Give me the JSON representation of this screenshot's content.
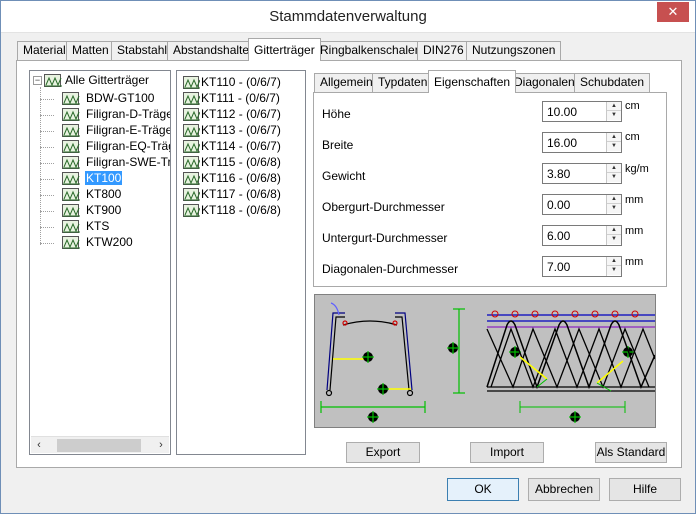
{
  "window": {
    "title": "Stammdatenverwaltung",
    "close_label": "✕"
  },
  "tabs": [
    "Material",
    "Matten",
    "Stabstahl",
    "Abstandshalter",
    "Gitterträger",
    "Ringbalkenschalen",
    "DIN276",
    "Nutzungszonen"
  ],
  "active_tab": "Gitterträger",
  "tree": {
    "root": "Alle Gitterträger",
    "items": [
      "BDW-GT100",
      "Filigran-D-Träger",
      "Filigran-E-Träger",
      "Filigran-EQ-Träger",
      "Filigran-SWE-Träg",
      "KT100",
      "KT800",
      "KT900",
      "KTS",
      "KTW200"
    ],
    "selected": "KT100"
  },
  "list": {
    "items": [
      "KT110 - (0/6/7)",
      "KT111 - (0/6/7)",
      "KT112 - (0/6/7)",
      "KT113 - (0/6/7)",
      "KT114 - (0/6/7)",
      "KT115 - (0/6/8)",
      "KT116 - (0/6/8)",
      "KT117 - (0/6/8)",
      "KT118 - (0/6/8)"
    ]
  },
  "subtabs": [
    "Allgemein",
    "Typdaten",
    "Eigenschaften",
    "Diagonalen",
    "Schubdaten"
  ],
  "active_subtab": "Eigenschaften",
  "properties": [
    {
      "label": "Höhe",
      "value": "10.00",
      "unit": "cm"
    },
    {
      "label": "Breite",
      "value": "16.00",
      "unit": "cm"
    },
    {
      "label": "Gewicht",
      "value": "3.80",
      "unit": "kg/m"
    },
    {
      "label": "Obergurt-Durchmesser",
      "value": "0.00",
      "unit": "mm"
    },
    {
      "label": "Untergurt-Durchmesser",
      "value": "6.00",
      "unit": "mm"
    },
    {
      "label": "Diagonalen-Durchmesser",
      "value": "7.00",
      "unit": "mm"
    }
  ],
  "buttons": {
    "export": "Export",
    "import": "Import",
    "standard": "Als Standard",
    "ok": "OK",
    "cancel": "Abbrechen",
    "help": "Hilfe"
  },
  "colors": {
    "selection": "#3399ff",
    "close": "#c75050",
    "drawing_bg": "#c0c0c0"
  }
}
